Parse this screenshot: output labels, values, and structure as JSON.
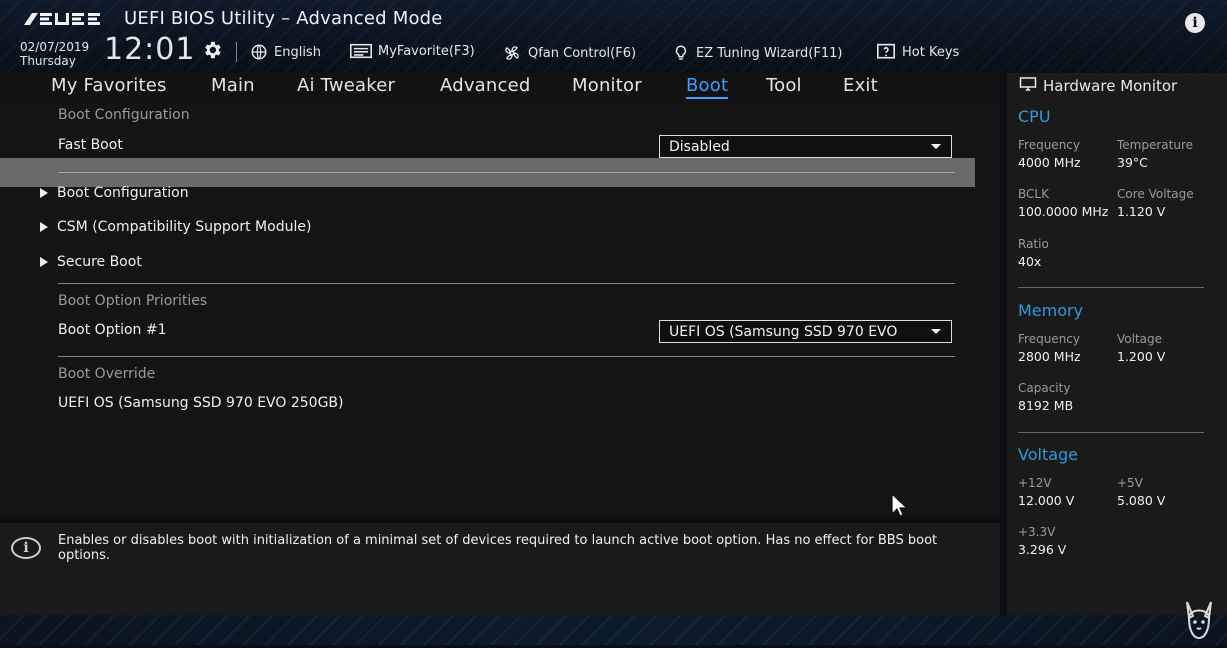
{
  "header": {
    "app_title": "UEFI BIOS Utility – Advanced Mode",
    "date": "02/07/2019",
    "day": "Thursday",
    "time": "12:01",
    "items": [
      {
        "label": "English",
        "icon": "globe-icon"
      },
      {
        "label": "MyFavorite(F3)",
        "icon": "favorite-list-icon"
      },
      {
        "label": "Qfan Control(F6)",
        "icon": "fan-icon"
      },
      {
        "label": "EZ Tuning Wizard(F11)",
        "icon": "lightbulb-icon"
      },
      {
        "label": "Hot Keys",
        "icon": "help-box-icon"
      }
    ]
  },
  "tabs": [
    {
      "label": "My Favorites"
    },
    {
      "label": "Main"
    },
    {
      "label": "Ai Tweaker"
    },
    {
      "label": "Advanced"
    },
    {
      "label": "Monitor"
    },
    {
      "label": "Boot",
      "active": true
    },
    {
      "label": "Tool"
    },
    {
      "label": "Exit"
    }
  ],
  "boot": {
    "section_boot_configuration": "Boot Configuration",
    "fast_boot_label": "Fast Boot",
    "fast_boot_value": "Disabled",
    "submenus": [
      "Boot Configuration",
      "CSM (Compatibility Support Module)",
      "Secure Boot"
    ],
    "section_boot_option_priorities": "Boot Option Priorities",
    "boot_option_1_label": "Boot Option #1",
    "boot_option_1_value": "UEFI OS (Samsung SSD 970 EVO",
    "section_boot_override": "Boot Override",
    "override_item": "UEFI OS (Samsung SSD 970 EVO 250GB)"
  },
  "help": {
    "text": "Enables or disables boot with initialization of a minimal set of devices required to launch active boot option. Has no effect for BBS boot options."
  },
  "hardware_monitor": {
    "title": "Hardware Monitor",
    "cpu": {
      "title": "CPU",
      "frequency_label": "Frequency",
      "frequency_value": "4000 MHz",
      "temperature_label": "Temperature",
      "temperature_value": "39°C",
      "bclk_label": "BCLK",
      "bclk_value": "100.0000 MHz",
      "core_voltage_label": "Core Voltage",
      "core_voltage_value": "1.120 V",
      "ratio_label": "Ratio",
      "ratio_value": "40x"
    },
    "memory": {
      "title": "Memory",
      "frequency_label": "Frequency",
      "frequency_value": "2800 MHz",
      "voltage_label": "Voltage",
      "voltage_value": "1.200 V",
      "capacity_label": "Capacity",
      "capacity_value": "8192 MB"
    },
    "voltage": {
      "title": "Voltage",
      "plus12_label": "+12V",
      "plus12_value": "12.000 V",
      "plus5_label": "+5V",
      "plus5_value": "5.080 V",
      "plus3_3_label": "+3.3V",
      "plus3_3_value": "3.296 V"
    }
  },
  "colors": {
    "accent": "#3aa0ff",
    "hw_section": "#2e9bd8",
    "highlight_row": "#6a6a6a"
  }
}
